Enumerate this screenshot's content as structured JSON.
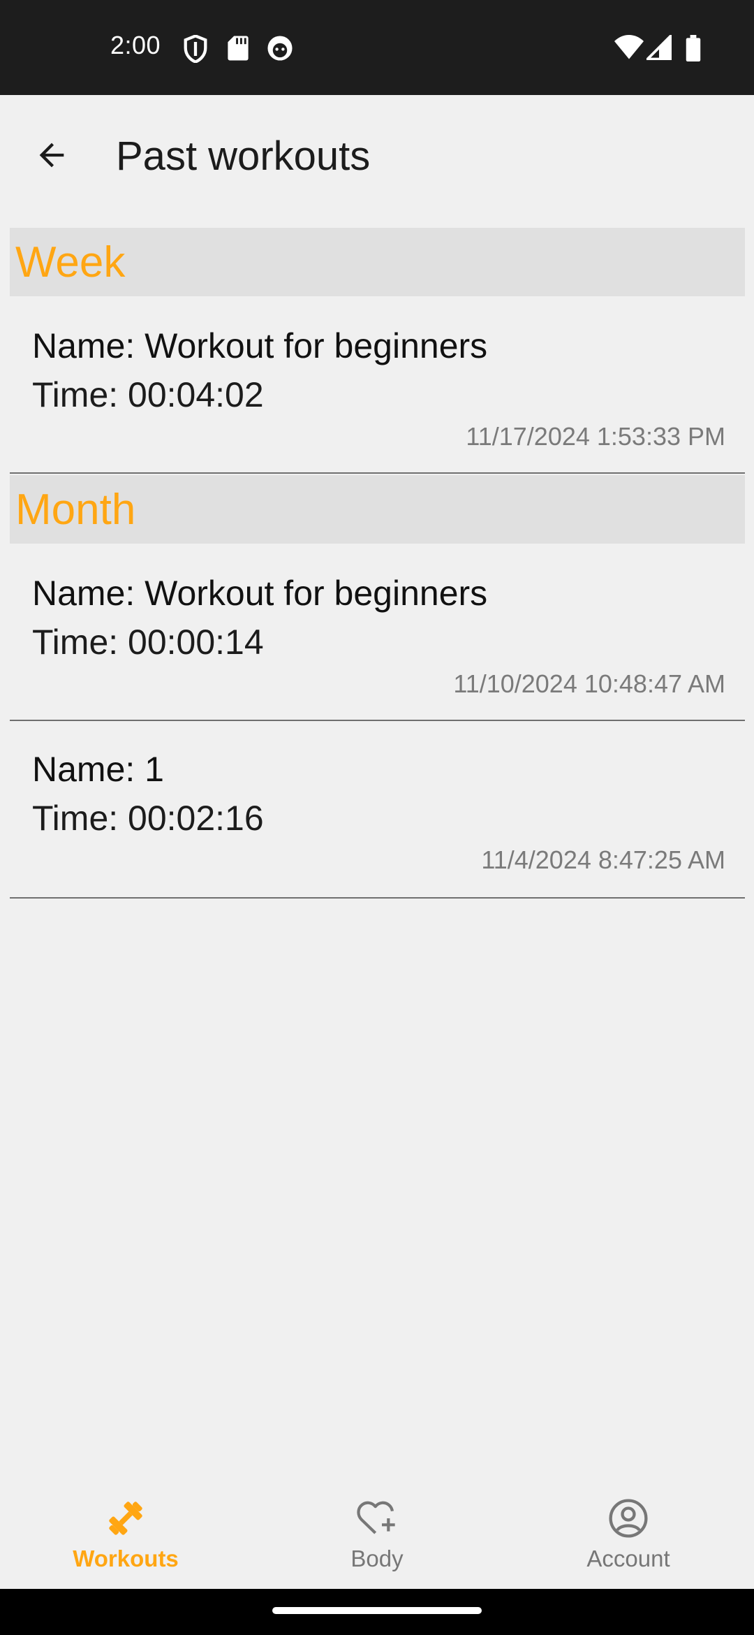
{
  "status_bar": {
    "time": "2:00",
    "left_icons": [
      "shield-icon",
      "sd-card-icon",
      "app-notification-icon"
    ],
    "right_icons": [
      "wifi-icon",
      "signal-icon",
      "battery-icon"
    ]
  },
  "toolbar": {
    "back_icon": "arrow-back-icon",
    "title": "Past workouts"
  },
  "sections": [
    {
      "header": "Week",
      "items": [
        {
          "name": "Name: Workout for beginners",
          "time": "Time: 00:04:02",
          "date": "11/17/2024 1:53:33 PM"
        }
      ]
    },
    {
      "header": "Month",
      "items": [
        {
          "name": "Name: Workout for beginners",
          "time": "Time: 00:00:14",
          "date": "11/10/2024 10:48:47 AM"
        },
        {
          "name": "Name: 1",
          "time": "Time: 00:02:16",
          "date": "11/4/2024 8:47:25 AM"
        }
      ]
    }
  ],
  "bottom_nav": {
    "items": [
      {
        "label": "Workouts",
        "icon": "dumbbell-icon",
        "active": true
      },
      {
        "label": "Body",
        "icon": "heart-plus-icon",
        "active": false
      },
      {
        "label": "Account",
        "icon": "account-circle-icon",
        "active": false
      }
    ]
  },
  "colors": {
    "accent": "#ffa613",
    "section_bg": "#e0e0e0",
    "background": "#f0f0f0",
    "status_bar": "#1d1d1d"
  }
}
